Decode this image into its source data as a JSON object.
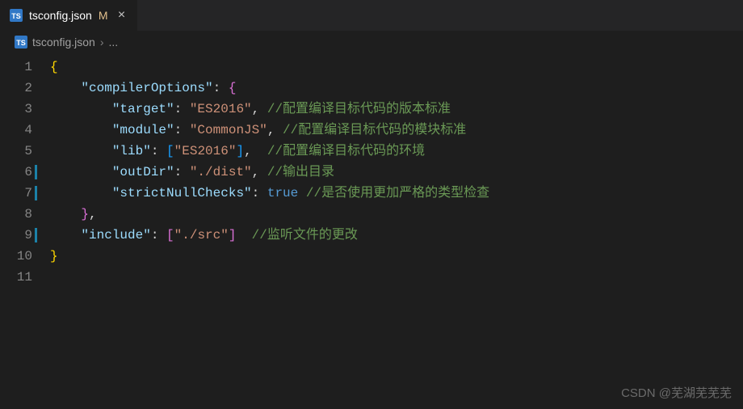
{
  "tab": {
    "filename": "tsconfig.json",
    "modified_indicator": "M"
  },
  "breadcrumb": {
    "filename": "tsconfig.json",
    "rest": "..."
  },
  "gutter": {
    "lines": [
      "1",
      "2",
      "3",
      "4",
      "5",
      "6",
      "7",
      "8",
      "9",
      "10",
      "11"
    ],
    "modified_lines": [
      6,
      7,
      9
    ]
  },
  "code": {
    "l1_open": "{",
    "l2_key": "\"compilerOptions\"",
    "l2_open": "{",
    "l3_key": "\"target\"",
    "l3_val": "\"ES2016\"",
    "l3_cm": "//配置编译目标代码的版本标准",
    "l4_key": "\"module\"",
    "l4_val": "\"CommonJS\"",
    "l4_cm": "//配置编译目标代码的模块标准",
    "l5_key": "\"lib\"",
    "l5_val": "\"ES2016\"",
    "l5_cm": "//配置编译目标代码的环境",
    "l6_key": "\"outDir\"",
    "l6_val": "\"./dist\"",
    "l6_cm": "//输出目录",
    "l7_key": "\"strictNullChecks\"",
    "l7_val": "true",
    "l7_cm": "//是否使用更加严格的类型检查",
    "l8_close": "}",
    "l9_key": "\"include\"",
    "l9_val": "\"./src\"",
    "l9_cm": "//监听文件的更改",
    "l10_close": "}"
  },
  "watermark": "CSDN @芜湖芜芜芜"
}
